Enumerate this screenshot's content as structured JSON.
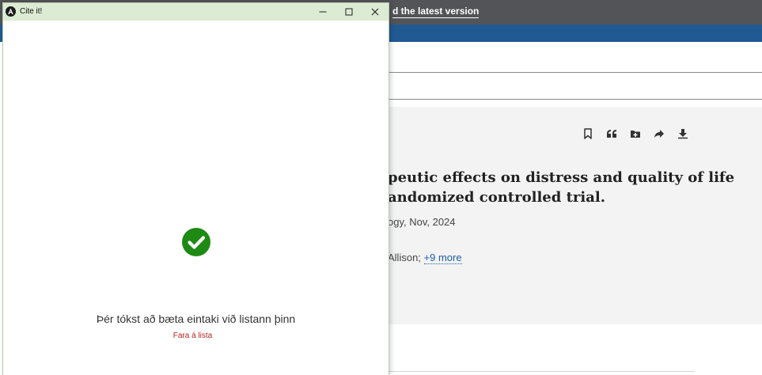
{
  "background": {
    "topbar": {
      "update_link": "d the latest version"
    },
    "record": {
      "title_line1": "peutic effects on distress and quality of life",
      "title_line2": "andomized controlled trial.",
      "journal": "ogy, Nov, 2024",
      "authors_prefix": "Allison; ",
      "more_link": "+9 more"
    },
    "action_icons": [
      "bookmark-icon",
      "quote-icon",
      "folder-add-icon",
      "share-icon",
      "download-icon"
    ]
  },
  "modal": {
    "title": "Cite it!",
    "success_message": "Þér tókst að bæta eintaki við listann þinn",
    "goto_list_link": "Fara á lista",
    "colors": {
      "titlebar": "#dcebd3",
      "check": "#1e8a14",
      "link": "#b3261e"
    }
  }
}
